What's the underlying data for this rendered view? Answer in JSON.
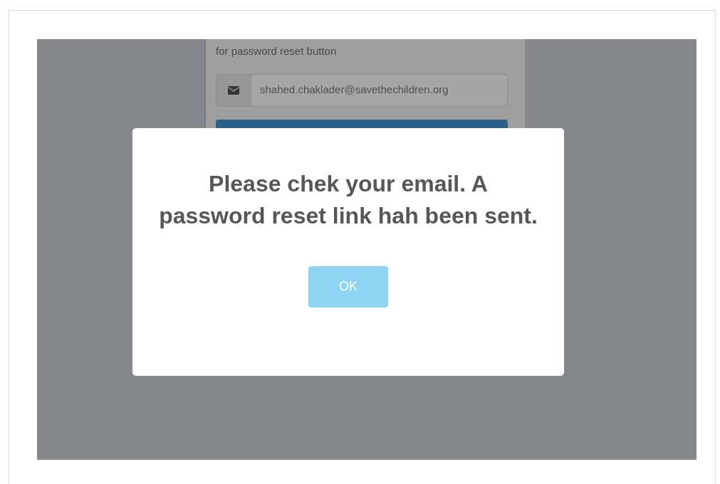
{
  "background_form": {
    "instruction": "for password reset button",
    "email_field": {
      "value": "shahed.chaklader@savethechildren.org"
    }
  },
  "dialog": {
    "message": "Please chek your email. A password reset link hah been sent.",
    "button": "OK"
  }
}
